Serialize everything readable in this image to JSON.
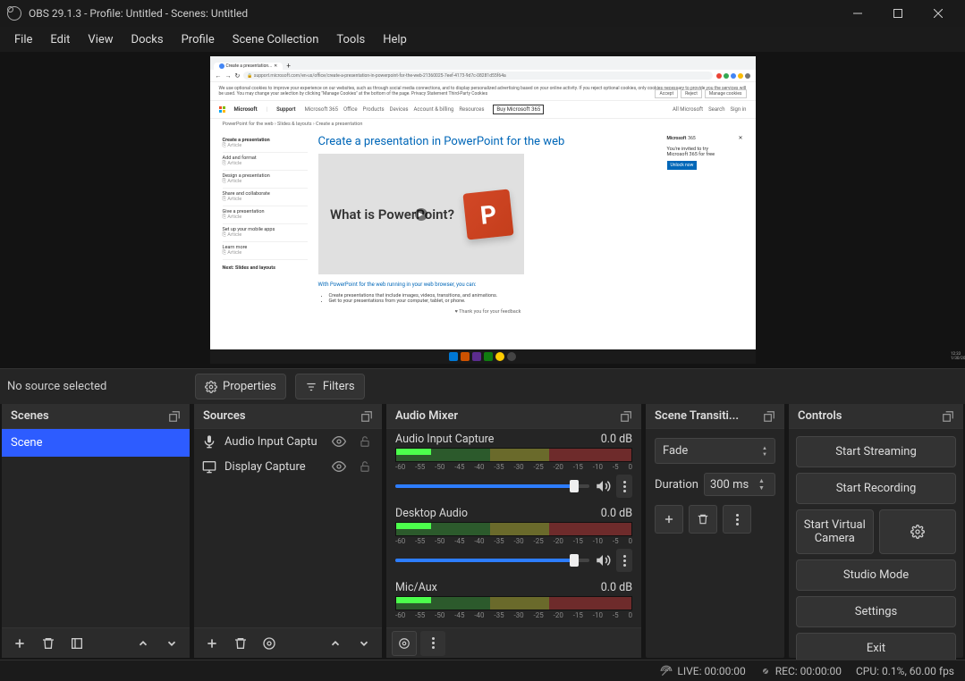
{
  "titlebar": {
    "title": "OBS 29.1.3 - Profile: Untitled - Scenes: Untitled"
  },
  "menubar": [
    "File",
    "Edit",
    "View",
    "Docks",
    "Profile",
    "Scene Collection",
    "Tools",
    "Help"
  ],
  "toolbar": {
    "status": "No source selected",
    "properties": "Properties",
    "filters": "Filters"
  },
  "panels": {
    "scenes": {
      "title": "Scenes",
      "items": [
        "Scene"
      ]
    },
    "sources": {
      "title": "Sources",
      "items": [
        {
          "icon": "mic",
          "label": "Audio Input Captu"
        },
        {
          "icon": "display",
          "label": "Display Capture"
        }
      ]
    },
    "mixer": {
      "title": "Audio Mixer",
      "ticks": [
        "-60",
        "-55",
        "-50",
        "-45",
        "-40",
        "-35",
        "-30",
        "-25",
        "-20",
        "-15",
        "-10",
        "-5",
        "0"
      ],
      "tracks": [
        {
          "name": "Audio Input Capture",
          "db": "0.0 dB",
          "vol": 92
        },
        {
          "name": "Desktop Audio",
          "db": "0.0 dB",
          "vol": 92
        },
        {
          "name": "Mic/Aux",
          "db": "0.0 dB",
          "vol": 92
        }
      ]
    },
    "transitions": {
      "title": "Scene Transiti...",
      "type": "Fade",
      "durationLabel": "Duration",
      "duration": "300 ms"
    },
    "controls": {
      "title": "Controls",
      "buttons": {
        "stream": "Start Streaming",
        "record": "Start Recording",
        "vcam": "Start Virtual Camera",
        "studio": "Studio Mode",
        "settings": "Settings",
        "exit": "Exit"
      }
    }
  },
  "statusbar": {
    "live": "LIVE: 00:00:00",
    "rec": "REC: 00:00:00",
    "cpu": "CPU: 0.1%, 60.00 fps"
  },
  "preview": {
    "tab": "Create a presentation... ",
    "url": "support.microsoft.com/en-us/office/create-a-presentation-in-powerpoint-for-the-web-21360025-7eef-4173-9d7c-08281d55f64a",
    "cookies": "We use optional cookies to improve your experience on our websites, such as through social media connections, and to display personalized advertising based on your online activity. If you reject optional cookies, only cookies necessary to provide you the services will be used. You may change your selection by clicking \"Manage Cookies\" at the bottom of the page. Privacy Statement  Third-Party Cookies",
    "nav": {
      "brand": "Microsoft",
      "support": "Support",
      "items": [
        "Microsoft 365",
        "Office",
        "Products",
        "Devices",
        "Account & billing",
        "Resources"
      ],
      "buy": "Buy Microsoft 365",
      "right": [
        "All Microsoft",
        "Search",
        "Sign in"
      ]
    },
    "breadcrumb": "PowerPoint for the web › Slides & layouts › Create a presentation",
    "sidebar": [
      {
        "t": "Create a presentation",
        "s": "Article"
      },
      {
        "t": "Add and format",
        "s": "Article"
      },
      {
        "t": "Design a presentation",
        "s": "Article"
      },
      {
        "t": "Share and collaborate",
        "s": "Article"
      },
      {
        "t": "Give a presentation",
        "s": "Article"
      },
      {
        "t": "Set up your mobile apps",
        "s": "Article"
      },
      {
        "t": "Learn more",
        "s": "Article"
      }
    ],
    "sideNext": "Next: Slides and layouts",
    "h1": "Create a presentation in PowerPoint for the web",
    "vidtext": "What is PowerPoint?",
    "lead": "With PowerPoint for the web running in your web browser, you can:",
    "bullets": [
      "Create presentations that include images, videos, transitions, and animations.",
      "Get to your presentations from your computer, tablet, or phone."
    ],
    "aside": {
      "line1": "You're invited to try",
      "line2": "Microsoft 365 for free",
      "cta": "Unlock now"
    }
  }
}
